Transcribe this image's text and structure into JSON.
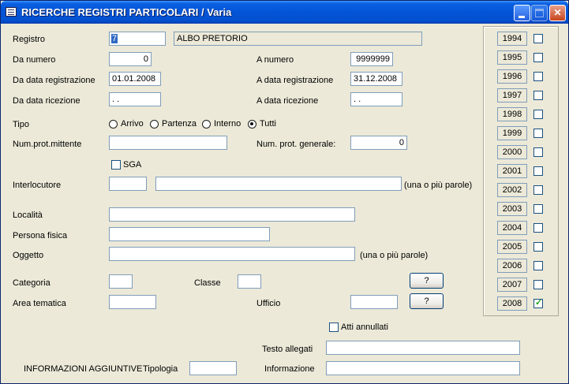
{
  "window": {
    "title": "RICERCHE REGISTRI PARTICOLARI / Varia"
  },
  "form": {
    "registro_label": "Registro",
    "registro_code": "7",
    "registro_name": "ALBO PRETORIO",
    "da_numero_label": "Da numero",
    "da_numero_value": "0",
    "a_numero_label": "A  numero",
    "a_numero_value": "9999999",
    "da_data_reg_label": "Da data registrazione",
    "da_data_reg_value": "01.01.2008",
    "a_data_reg_label": "A  data registrazione",
    "a_data_reg_value": "31.12.2008",
    "da_data_ric_label": "Da data ricezione",
    "da_data_ric_value": " .  .",
    "a_data_ric_label": "A  data ricezione",
    "a_data_ric_value": " .  .",
    "tipo_label": "Tipo",
    "tipo_options": [
      "Arrivo",
      "Partenza",
      "Interno",
      "Tutti"
    ],
    "tipo_selected": "Tutti",
    "num_prot_mitt_label": "Num.prot.mittente",
    "num_prot_mitt_value": "",
    "num_prot_gen_label": "Num. prot. generale:",
    "num_prot_gen_value": "0",
    "sga_label": "SGA",
    "sga_checked": false,
    "interlocutore_label": "Interlocutore",
    "interlocutore_code": "",
    "interlocutore_value": "",
    "words_hint": "(una o più parole)",
    "localita_label": "Località",
    "localita_value": "",
    "persona_fisica_label": "Persona fisica",
    "persona_fisica_value": "",
    "oggetto_label": "Oggetto",
    "oggetto_value": "",
    "categoria_label": "Categoria",
    "categoria_value": "",
    "classe_label": "Classe",
    "classe_value": "",
    "lookup_button_label": "?",
    "area_tematica_label": "Area tematica",
    "area_tematica_value": "",
    "ufficio_label": "Ufficio",
    "ufficio_value": "",
    "atti_annullati_label": "Atti annullati",
    "atti_annullati_checked": false,
    "testo_allegati_label": "Testo allegati",
    "testo_allegati_value": "",
    "info_aggiuntive_label": "INFORMAZIONI AGGIUNTIVE",
    "tipologia_label": "Tipologia",
    "tipologia_value": "",
    "informazione_label": "Informazione",
    "informazione_value": ""
  },
  "years": [
    {
      "label": "1994",
      "checked": false
    },
    {
      "label": "1995",
      "checked": false
    },
    {
      "label": "1996",
      "checked": false
    },
    {
      "label": "1997",
      "checked": false
    },
    {
      "label": "1998",
      "checked": false
    },
    {
      "label": "1999",
      "checked": false
    },
    {
      "label": "2000",
      "checked": false
    },
    {
      "label": "2001",
      "checked": false
    },
    {
      "label": "2002",
      "checked": false
    },
    {
      "label": "2003",
      "checked": false
    },
    {
      "label": "2004",
      "checked": false
    },
    {
      "label": "2005",
      "checked": false
    },
    {
      "label": "2006",
      "checked": false
    },
    {
      "label": "2007",
      "checked": false
    },
    {
      "label": "2008",
      "checked": true
    }
  ],
  "colors": {
    "titlebar": "#0454d6",
    "window_bg": "#ece9d8",
    "field_border": "#7f9db9",
    "selection": "#316ac5"
  }
}
